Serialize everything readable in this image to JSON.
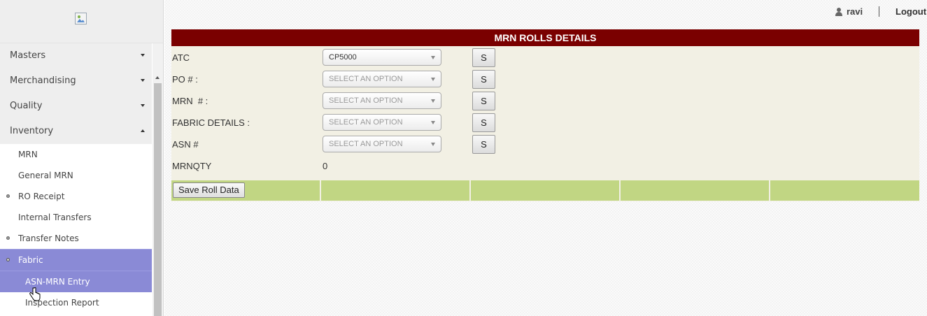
{
  "sidebar": {
    "menu": [
      {
        "label": "Masters"
      },
      {
        "label": "Merchandising"
      },
      {
        "label": "Quality"
      },
      {
        "label": "Inventory"
      }
    ],
    "inventory_items": [
      {
        "label": "MRN"
      },
      {
        "label": "General MRN"
      },
      {
        "label": "RO Receipt"
      },
      {
        "label": "Internal Transfers"
      },
      {
        "label": "Transfer Notes"
      },
      {
        "label": "Fabric"
      },
      {
        "label": "ASN-MRN Entry"
      },
      {
        "label": "Inspection Report"
      }
    ]
  },
  "header": {
    "username": "ravi",
    "logout_label": "Logout"
  },
  "panel": {
    "title": "MRN ROLLS DETAILS",
    "rows": [
      {
        "label": "ATC",
        "value": "CP5000",
        "button": "S"
      },
      {
        "label": "PO # :",
        "value": "SELECT AN OPTION",
        "button": "S"
      },
      {
        "label": "MRN  # :",
        "value": "SELECT AN OPTION",
        "button": "S"
      },
      {
        "label": "FABRIC DETAILS :",
        "value": "SELECT AN OPTION",
        "button": "S"
      },
      {
        "label": "ASN #",
        "value": "SELECT AN OPTION",
        "button": "S"
      }
    ],
    "qty": {
      "label": "MRNQTY",
      "value": "0"
    },
    "save_label": "Save Roll Data"
  },
  "colors": {
    "header_bg": "#7a0000",
    "panel_bg": "#f2f0e4",
    "action_bar": "#c1d683",
    "active_menu": "#8a8ad6"
  }
}
